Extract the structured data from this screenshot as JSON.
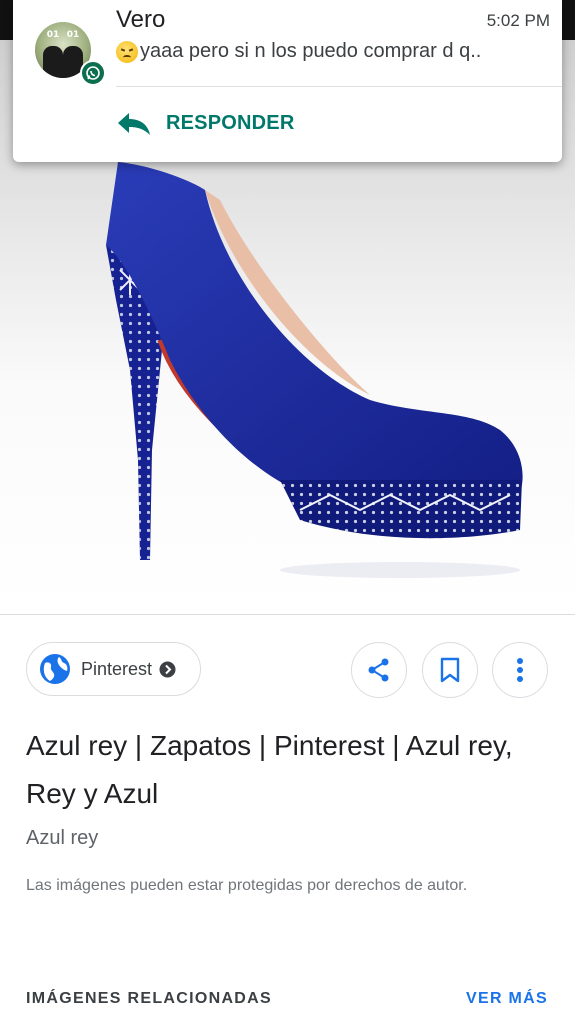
{
  "notification": {
    "sender": "Vero",
    "time": "5:02 PM",
    "message": "yaaa pero si n los puedo comprar d q..",
    "emoji": "persevering-face",
    "avatar_numbers": [
      "01",
      "01"
    ],
    "app_icon": "whatsapp-icon",
    "reply_label": "RESPONDER",
    "accent_color": "#00796b"
  },
  "image": {
    "subject": "blue-high-heel-shoe",
    "colors": {
      "shoe": "#1a2a9c",
      "sole": "#c0392b",
      "studs": "#d8dbe6"
    }
  },
  "result": {
    "source": "Pinterest",
    "title": "Azul rey | Zapatos | Pinterest | Azul rey, Rey y Azul",
    "subtitle": "Azul rey",
    "notice": "Las imágenes pueden estar protegidas por derechos de autor.",
    "actions": [
      "share-icon",
      "bookmark-icon",
      "more-vert-icon"
    ]
  },
  "related": {
    "heading": "IMÁGENES RELACIONADAS",
    "more_label": "VER MÁS",
    "link_color": "#1a73e8"
  }
}
